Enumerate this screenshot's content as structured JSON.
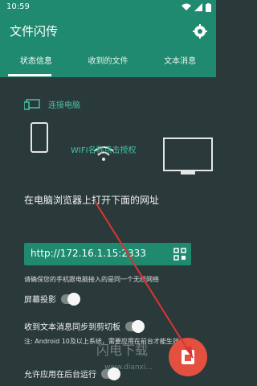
{
  "statusbar": {
    "time": "10:59"
  },
  "appbar": {
    "title": "文件闪传"
  },
  "tabs": [
    {
      "label": "状态信息"
    },
    {
      "label": "收到的文件"
    },
    {
      "label": "文本消息"
    }
  ],
  "connect": {
    "label": "连接电脑"
  },
  "wifi": {
    "label": "WIFI名称点击授权"
  },
  "main": {
    "description": "在电脑浏览器上打开下面的网址",
    "url": "http://172.16.1.15:2333",
    "note1": "请确保您的手机跟电脑接入的是同一个无线网络",
    "settings": [
      {
        "label": "屏幕投影"
      },
      {
        "label": "收到文本消息同步到剪切板"
      },
      {
        "label": "允许应用在后台运行"
      }
    ],
    "note2": "注: Android 10及以上系统，需要应用在前台才能生效"
  },
  "watermark": {
    "text": "闪电下载",
    "sub": "www.dianxi..."
  },
  "colors": {
    "primary": "#1f8a6f",
    "accent": "#45c2a3",
    "fab": "#e3503f"
  }
}
